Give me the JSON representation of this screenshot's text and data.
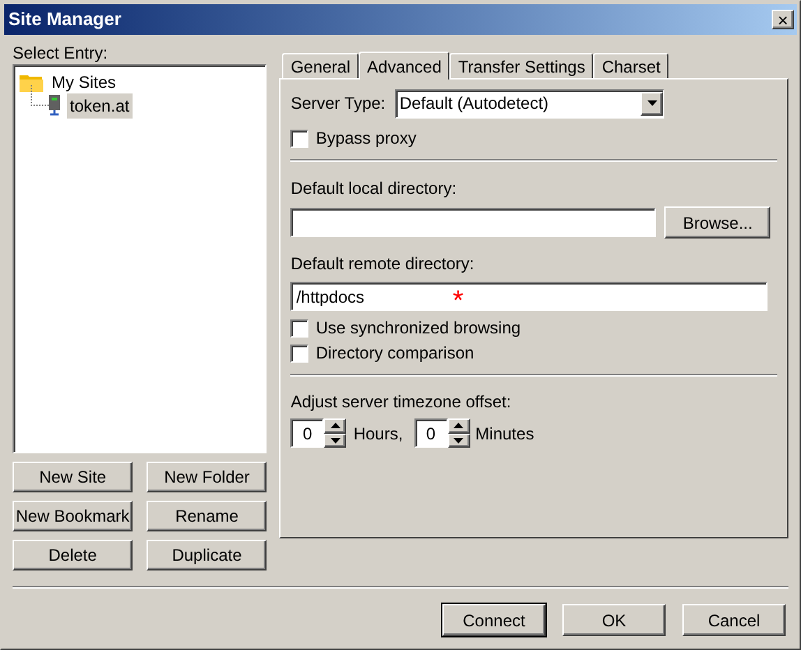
{
  "window": {
    "title": "Site Manager",
    "close": "×"
  },
  "entry_label": "Select Entry:",
  "tree": [
    {
      "label": "My Sites",
      "kind": "folder",
      "children": [
        {
          "label": "token.at",
          "kind": "site",
          "selected": true
        }
      ]
    }
  ],
  "left_buttons": [
    "New Site",
    "New Folder",
    "New Bookmark",
    "Rename",
    "Delete",
    "Duplicate"
  ],
  "tabs": [
    {
      "label": "General",
      "selected": false
    },
    {
      "label": "Advanced",
      "selected": true
    },
    {
      "label": "Transfer Settings",
      "selected": false
    },
    {
      "label": "Charset",
      "selected": false
    }
  ],
  "server_type": {
    "label": "Server Type:",
    "value": "Default (Autodetect)"
  },
  "bypass_proxy": {
    "label": "Bypass proxy",
    "checked": false
  },
  "local_dir": {
    "label": "Default local directory:",
    "button": "Browse..."
  },
  "remote_dir": {
    "label": "Default remote directory:",
    "value": "/httpdocs",
    "marker": "*"
  },
  "sync_browsing": {
    "label": "Use synchronized browsing",
    "checked": false
  },
  "dir_comparison": {
    "label": "Directory comparison",
    "checked": false
  },
  "timezone": {
    "label": "Adjust server timezone offset:",
    "hours": "0",
    "hours_label": "Hours,",
    "minutes": "0",
    "minutes_label": "Minutes"
  },
  "footer_buttons": [
    {
      "label": "Connect",
      "default": true
    },
    {
      "label": "OK",
      "default": false
    },
    {
      "label": "Cancel",
      "default": false
    }
  ]
}
